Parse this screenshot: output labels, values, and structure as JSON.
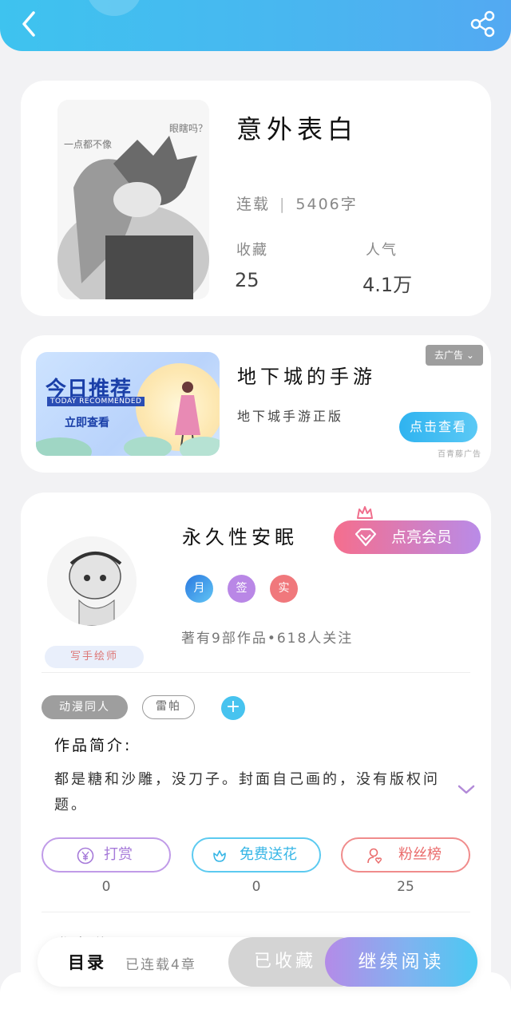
{
  "header": {
    "back_icon": "back-arrow-icon",
    "share_icon": "share-icon"
  },
  "book": {
    "title": "意外表白",
    "status": "连载",
    "word_count": "5406字",
    "favorites_label": "收藏",
    "favorites_value": "25",
    "popularity_label": "人气",
    "popularity_value": "4.1万",
    "cover_text_left": "一点都不像",
    "cover_text_right": "眼瞎吗？"
  },
  "ad": {
    "banner_title": "今日推荐",
    "banner_sub": "TODAY RECOMMENDED",
    "banner_cta": "立即查看",
    "title": "地下城的手游",
    "desc": "地下城手游正版",
    "close_label": "去广告",
    "button_label": "点击查看",
    "source": "百青藤广告"
  },
  "author": {
    "name": "永久性安眠",
    "vip_label": "点亮会员",
    "tag_label": "写手绘师",
    "badges": [
      "月",
      "签",
      "实"
    ],
    "stats": "著有9部作品•618人关注"
  },
  "tags": {
    "items": [
      "动漫同人",
      "雷帕"
    ],
    "add_label": "+"
  },
  "intro": {
    "title": "作品简介:",
    "text": "都是糖和沙雕，没刀子。封面自己画的，没有版权问题。"
  },
  "actions": [
    {
      "label": "打赏",
      "count": "0"
    },
    {
      "label": "免费送花",
      "count": "0"
    },
    {
      "label": "粉丝榜",
      "count": "25"
    }
  ],
  "partial_text": "作者说",
  "bottom": {
    "toc_label": "目录",
    "toc_sub": "已连载4章",
    "fav_label": "已收藏",
    "read_label": "继续阅读"
  },
  "colors": {
    "header": "#49b6f0",
    "vip_start": "#f56e8d",
    "vip_end": "#b98be8",
    "accent_blue": "#47c3ef"
  }
}
